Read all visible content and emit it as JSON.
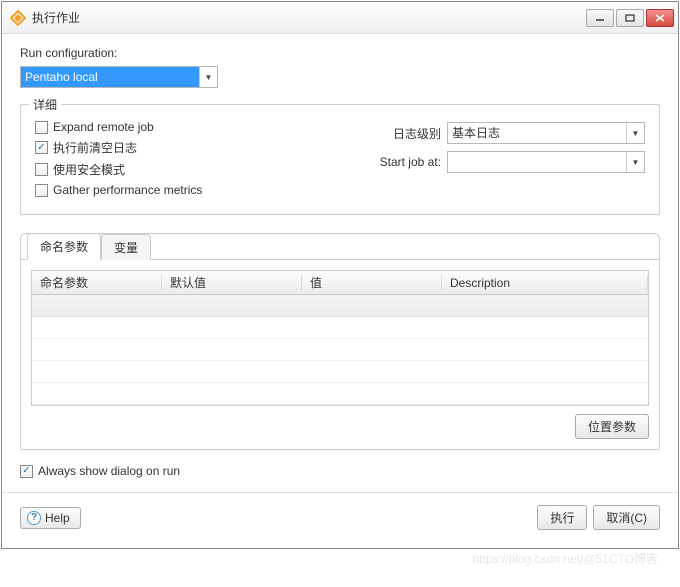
{
  "window": {
    "title": "执行作业"
  },
  "runconfig": {
    "label": "Run configuration:",
    "value": "Pentaho local"
  },
  "details": {
    "legend": "详细",
    "expand_remote": {
      "label": "Expand remote job",
      "checked": false
    },
    "clear_log": {
      "label": "执行前清空日志",
      "checked": true
    },
    "safe_mode": {
      "label": "使用安全模式",
      "checked": false
    },
    "gather_metrics": {
      "label": "Gather performance metrics",
      "checked": false
    },
    "log_level": {
      "label": "日志级别",
      "value": "基本日志"
    },
    "start_at": {
      "label": "Start job at:",
      "value": ""
    }
  },
  "tabs": {
    "named_params": "命名参数",
    "variables": "变量"
  },
  "table": {
    "headers": {
      "c1": "命名参数",
      "c2": "默认值",
      "c3": "值",
      "c4": "Description"
    },
    "position_params_btn": "位置参数"
  },
  "always_show": {
    "label": "Always show dialog on run",
    "checked": true
  },
  "footer": {
    "help": "Help",
    "run": "执行",
    "cancel": "取消(C)"
  },
  "watermark": "https://blog.csdn.net/@51CTO博客"
}
